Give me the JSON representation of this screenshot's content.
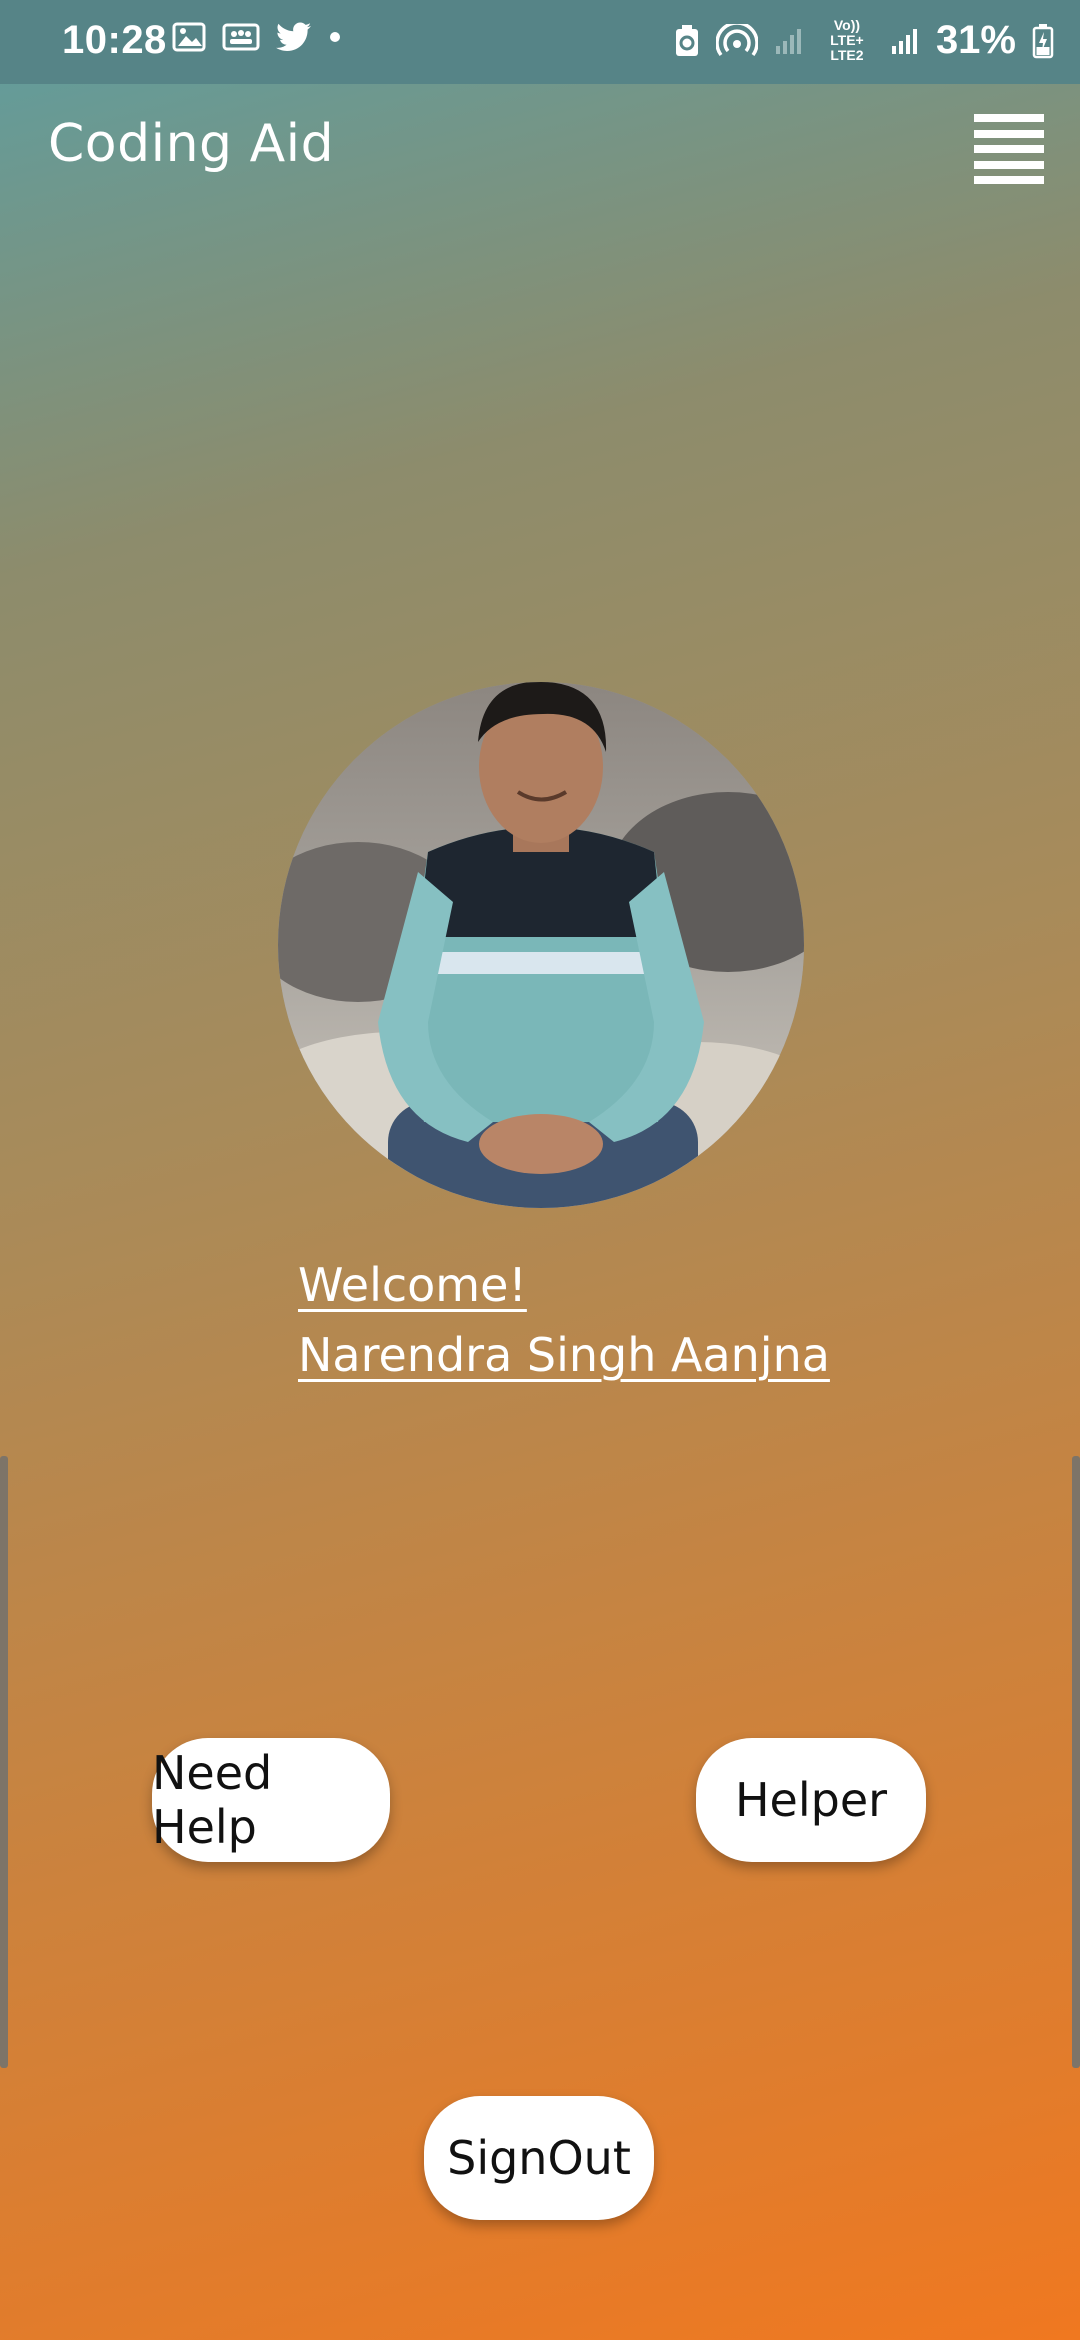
{
  "status_bar": {
    "time": "10:28",
    "network": "Vo)) LTE+ LTE2",
    "battery_percent": "31%",
    "left_icons": [
      "gallery-icon",
      "group-icon",
      "twitter-icon",
      "dot-icon"
    ],
    "right_icons": [
      "battery-saver-icon",
      "hotspot-icon",
      "signal-icon",
      "signal-icon",
      "battery-icon"
    ]
  },
  "toolbar": {
    "title": "Coding Aid",
    "menu_icon": "hamburger-menu-icon"
  },
  "profile": {
    "welcome": "Welcome!",
    "name": "Narendra Singh Aanjna"
  },
  "actions": {
    "need_help": "Need Help",
    "helper": "Helper",
    "sign_out": "SignOut"
  },
  "colors": {
    "gradient_top": "#5e9ea0",
    "gradient_bottom": "#f07820",
    "status_bar": "#568487",
    "button_bg": "#ffffff"
  }
}
